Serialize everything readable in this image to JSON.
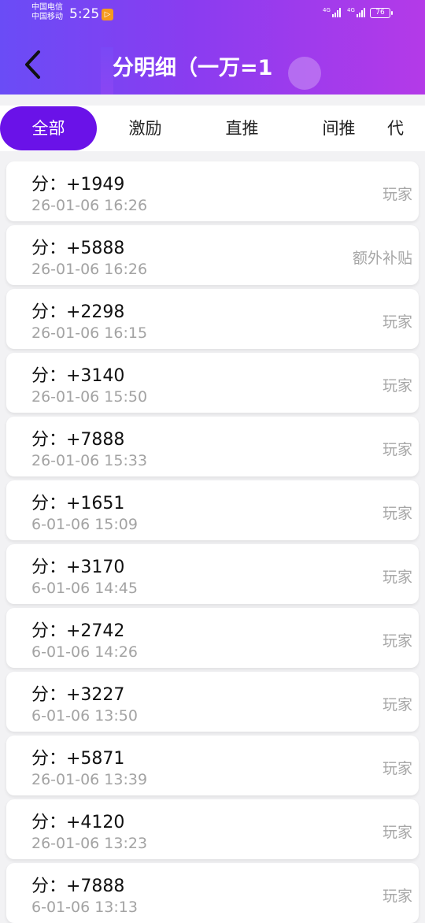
{
  "status_bar": {
    "carrier_line1": "中国电信",
    "carrier_line2": "中国移动",
    "time": "5:25",
    "signal1_label": "4G",
    "signal2_label": "4G",
    "battery": "76"
  },
  "header": {
    "title": "分明细（一万=1 ",
    "back_icon": "chevron-left-icon"
  },
  "tabs": [
    {
      "label": "全部",
      "active": true
    },
    {
      "label": "激励",
      "active": false
    },
    {
      "label": "直推",
      "active": false
    },
    {
      "label": "间推",
      "active": false
    },
    {
      "label": "代",
      "active": false
    }
  ],
  "records": [
    {
      "points": "分：+1949",
      "time": "26-01-06 16:26",
      "source": "玩家"
    },
    {
      "points": "分：+5888",
      "time": "26-01-06 16:26",
      "source": "额外补贴"
    },
    {
      "points": "分：+2298",
      "time": "26-01-06 16:15",
      "source": "玩家"
    },
    {
      "points": "分：+3140",
      "time": "26-01-06 15:50",
      "source": "玩家"
    },
    {
      "points": "分：+7888",
      "time": "26-01-06 15:33",
      "source": "玩家"
    },
    {
      "points": "分：+1651",
      "time": "6-01-06 15:09",
      "source": "玩家"
    },
    {
      "points": "分：+3170",
      "time": "6-01-06 14:45",
      "source": "玩家"
    },
    {
      "points": "分：+2742",
      "time": "6-01-06 14:26",
      "source": "玩家"
    },
    {
      "points": "分：+3227",
      "time": "6-01-06 13:50",
      "source": "玩家"
    },
    {
      "points": "分：+5871",
      "time": "26-01-06 13:39",
      "source": "玩家"
    },
    {
      "points": "分：+4120",
      "time": "26-01-06 13:23",
      "source": "玩家"
    },
    {
      "points": "分：+7888",
      "time": "6-01-06 13:13",
      "source": "玩家"
    }
  ],
  "colors": {
    "header_start": "#6a4cf6",
    "header_end": "#b43ae8",
    "tab_active": "#6a12e8"
  }
}
